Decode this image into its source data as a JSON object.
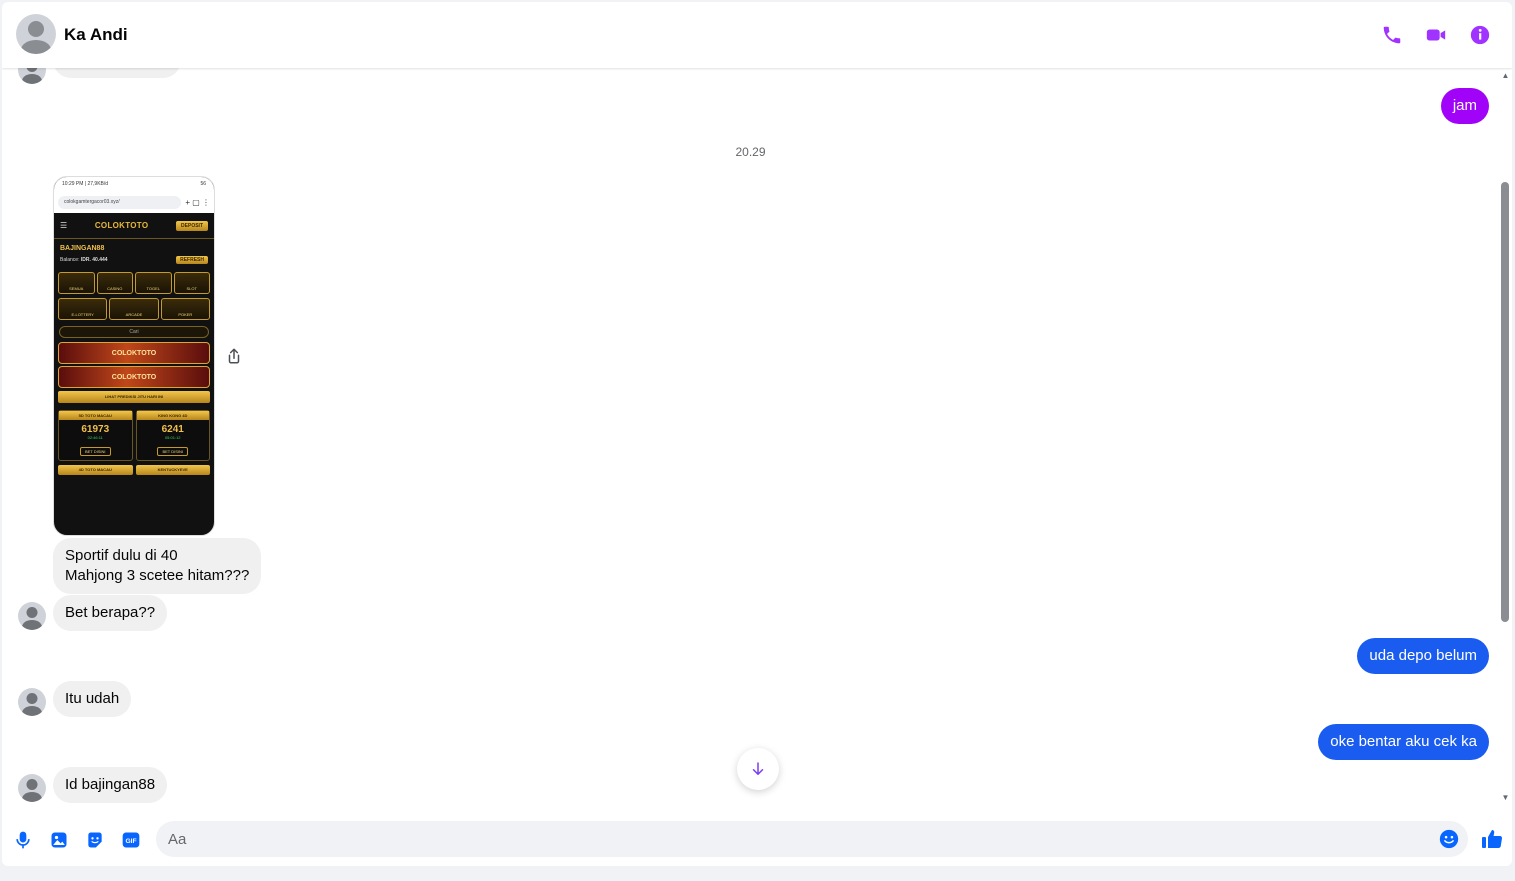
{
  "header": {
    "contact_name": "Ka Andi"
  },
  "thread": {
    "messages": [
      {
        "from": "me",
        "text": "jam"
      },
      {
        "type": "timestamp",
        "text": "20.29"
      },
      {
        "from": "them",
        "type": "image"
      },
      {
        "from": "them",
        "text": "Sportif dulu di 40\nMahjong 3 scetee hitam???"
      },
      {
        "from": "them",
        "text": "Bet berapa??"
      },
      {
        "from": "me",
        "text": "uda depo belum"
      },
      {
        "from": "them",
        "text": "Itu udah"
      },
      {
        "from": "me",
        "text": "oke bentar aku cek ka"
      },
      {
        "from": "them",
        "text": "Id bajingan88"
      }
    ]
  },
  "screenshot": {
    "status_left": "10:29 PM | 27,9KB/d",
    "status_right": "56",
    "url": "colokgamtergacor03.xyz/",
    "logo": "COLOKTOTO",
    "deposit": "DEPOSIT",
    "username": "BAJINGAN88",
    "balance_label": "Balance:",
    "balance_value": "IDR. 40.444",
    "refresh": "REFRESH",
    "tiles": [
      "SEMUA",
      "CASINO",
      "TOGEL",
      "SLOT"
    ],
    "tiles2": [
      "E-LOTTERY",
      "ARCADE",
      "POKER"
    ],
    "search": "Cari",
    "banner1": "COLOKTOTO",
    "banner2": "COLOKTOTO",
    "predik": "LIHAT PREDIKSI JITU HARI INI",
    "result1_title": "5D TOTO MACAU",
    "result1_num": "61973",
    "result1_time": "02:46:11",
    "result2_title": "KING KONG 4D",
    "result2_num": "6241",
    "result2_time": "05:01:12",
    "bet_label": "BET DISINI",
    "bottom1": "4D TOTO MACAU",
    "bottom2": "KENTUCKYEVE"
  },
  "composer": {
    "placeholder": "Aa"
  },
  "colors": {
    "accent": "#a033ff",
    "out_purple": "#a103f8",
    "out_blue": "#1a5cf0",
    "blue_icon": "#0866ff"
  },
  "icons": [
    "phone-icon",
    "video-icon",
    "info-icon",
    "microphone-icon",
    "image-icon",
    "sticker-icon",
    "gif-icon",
    "emoji-icon",
    "like-icon",
    "share-icon",
    "arrow-down-icon"
  ]
}
